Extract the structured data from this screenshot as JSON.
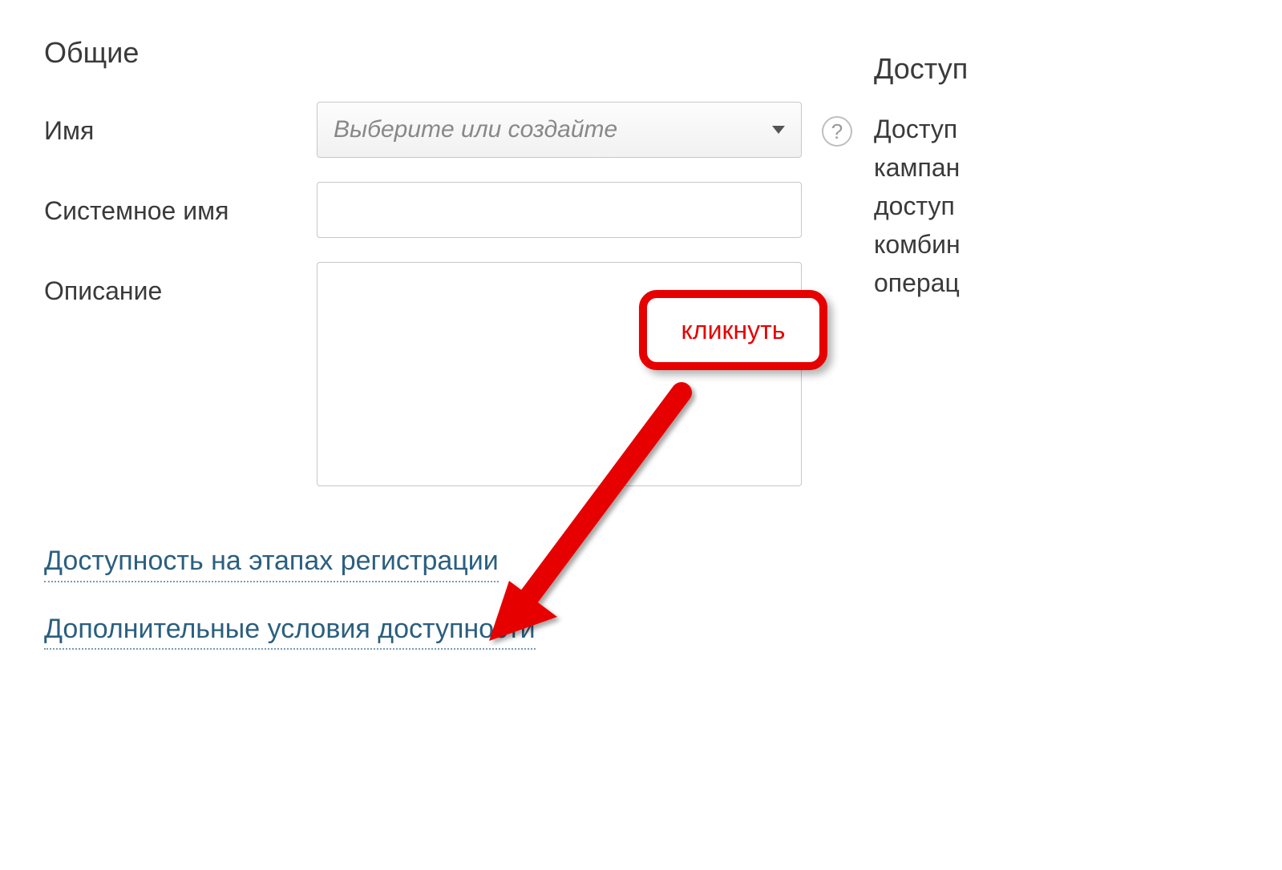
{
  "section": {
    "title": "Общие"
  },
  "fields": {
    "name": {
      "label": "Имя",
      "placeholder": "Выберите или создайте",
      "help": "?"
    },
    "systemName": {
      "label": "Системное имя"
    },
    "description": {
      "label": "Описание"
    }
  },
  "links": {
    "availability": "Доступность на этапах регистрации",
    "additional": "Дополнительные условия доступности"
  },
  "rightPanel": {
    "title": "Доступ",
    "line1": "Доступ",
    "line2": "кампан",
    "line3": "доступ",
    "line4": "комбин",
    "line5": "операц"
  },
  "annotation": {
    "label": "кликнуть"
  }
}
